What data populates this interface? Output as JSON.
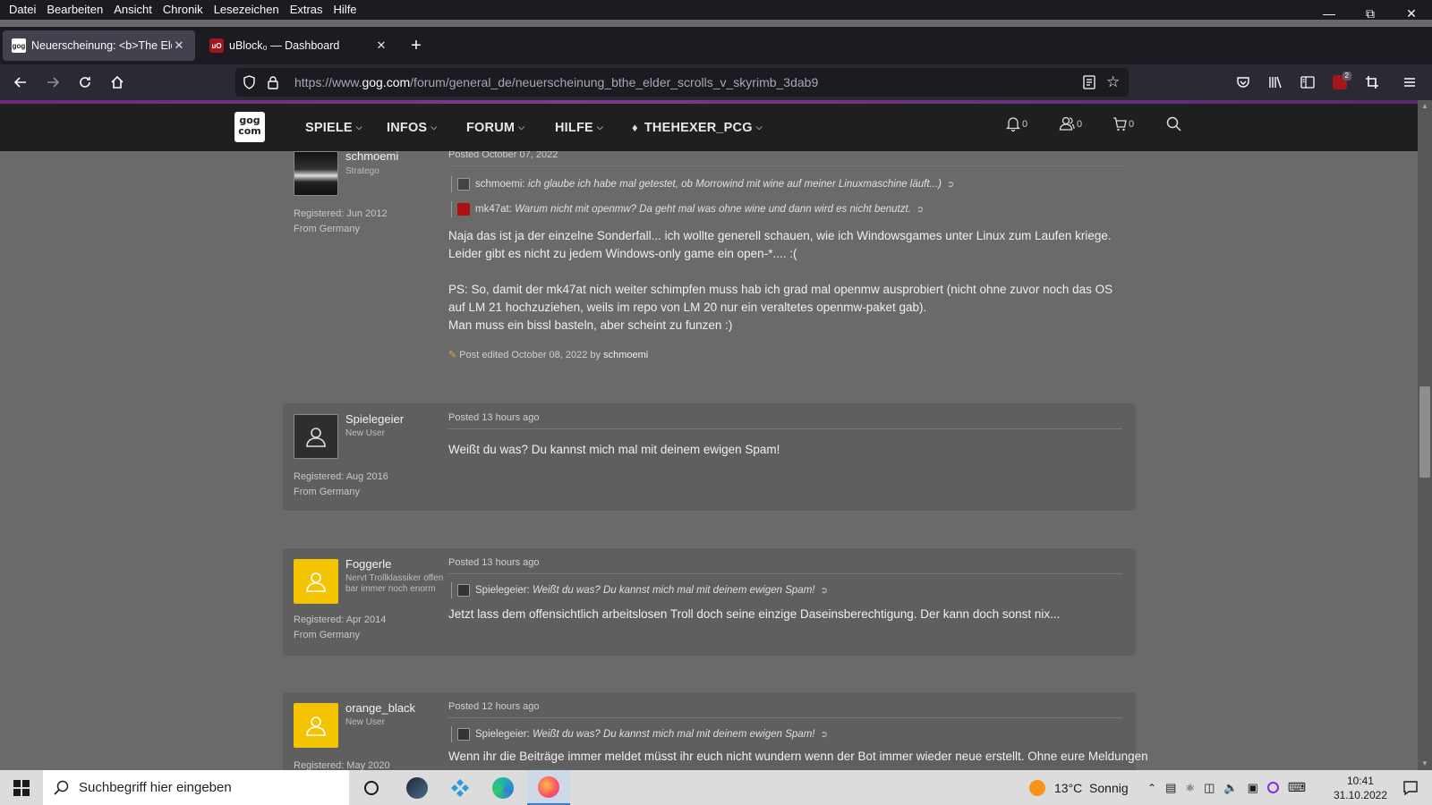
{
  "menubar": [
    "Datei",
    "Bearbeiten",
    "Ansicht",
    "Chronik",
    "Lesezeichen",
    "Extras",
    "Hilfe"
  ],
  "tabs": [
    {
      "title": "Neuerscheinung: <b>The Elder"
    },
    {
      "title": "uBlock₀ — Dashboard"
    }
  ],
  "navbar": {
    "url_prefix": "https://www.",
    "url_host": "gog.com",
    "url_path": "/forum/general_de/neuerscheinung_bthe_elder_scrolls_v_skyrimb_3dab9",
    "ublock_count": "2"
  },
  "gog": {
    "logo": "gog com",
    "nav": [
      "SPIELE",
      "INFOS",
      "FORUM",
      "HILFE"
    ],
    "user": "THEHEXER_PCG",
    "notifications": "0",
    "friends": "0",
    "cart": "0"
  },
  "posts": [
    {
      "username": "schmoemi",
      "rank": "Stratego",
      "registered": "Registered: Jun 2012",
      "from": "From Germany",
      "posted": "Posted October 07, 2022",
      "quotes": [
        {
          "author": "schmoemi:",
          "text": "ich glaube ich habe mal getestet, ob Morrowind mit wine auf meiner Linuxmaschine läuft...)"
        },
        {
          "author": "mk47at:",
          "text": "Warum nicht mit openmw? Da geht mal was ohne wine und dann wird es nicht benutzt."
        }
      ],
      "body": "Naja das ist ja der einzelne Sonderfall... ich wollte generell schauen, wie ich Windowsgames unter Linux zum Laufen kriege. Leider gibt es nicht zu jedem Windows-only game ein open-*.... :(\n\nPS: So, damit der mk47at nich weiter schimpfen muss hab ich grad mal openmw ausprobiert (nicht ohne zuvor noch das OS auf LM 21 hochzuziehen, weils im repo von LM 20 nur ein veraltetes openmw-paket gab).\nMan muss ein bissl basteln, aber scheint zu funzen :)",
      "edited": "Post edited October 08, 2022 by",
      "edited_by": "schmoemi"
    },
    {
      "username": "Spielegeier",
      "rank": "New User",
      "registered": "Registered: Aug 2016",
      "from": "From Germany",
      "posted": "Posted 13 hours ago",
      "body": "Weißt du was? Du kannst mich mal mit deinem ewigen Spam!"
    },
    {
      "username": "Foggerle",
      "rank": "Nervt Trollklassiker offen bar immer noch enorm",
      "registered": "Registered: Apr 2014",
      "from": "From Germany",
      "posted": "Posted 13 hours ago",
      "quotes": [
        {
          "author": "Spielegeier:",
          "text": "Weißt du was? Du kannst mich mal mit deinem ewigen Spam!"
        }
      ],
      "body": "Jetzt lass dem offensichtlich arbeitslosen Troll doch seine einzige Daseinsberechtigung. Der kann doch sonst nix..."
    },
    {
      "username": "orange_black",
      "rank": "New User",
      "registered": "Registered: May 2020",
      "posted": "Posted 12 hours ago",
      "quotes": [
        {
          "author": "Spielegeier:",
          "text": "Weißt du was? Du kannst mich mal mit deinem ewigen Spam!"
        }
      ],
      "body": "Wenn ihr die Beiträge immer meldet müsst ihr euch nicht wundern wenn der Bot immer wieder neue erstellt. Ohne eure Meldungen"
    }
  ],
  "taskbar": {
    "search_placeholder": "Suchbegriff hier eingeben",
    "weather": "13°C  Sonnig",
    "time": "10:41",
    "date": "31.10.2022"
  }
}
